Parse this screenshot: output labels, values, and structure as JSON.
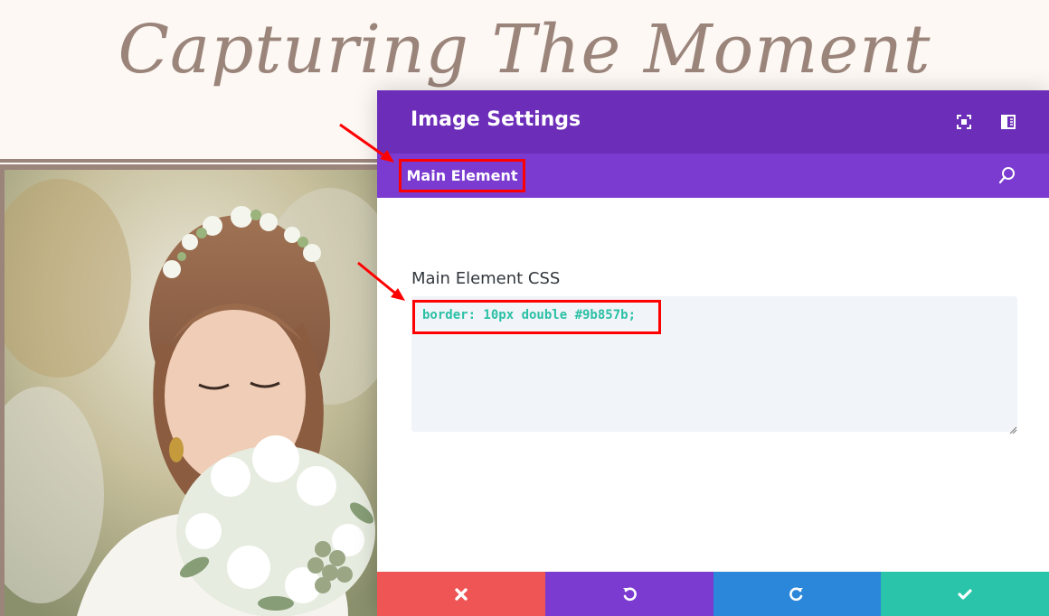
{
  "page": {
    "hero_title": "Capturing The Moment",
    "accent_color": "#9b857b"
  },
  "modal": {
    "title": "Image Settings",
    "header_icons": [
      "expand-icon",
      "sidebar-toggle-icon"
    ],
    "active_tab": "Main Element",
    "search_icon": "search-icon",
    "field_label": "Main Element CSS",
    "css_value": "border: 10px double #9b857b;",
    "colors": {
      "header": "#6c2eb9",
      "subbar": "#7b3bd0",
      "cancel": "#ef5555",
      "undo": "#7b3bd0",
      "redo": "#2b87da",
      "save": "#29c4a9",
      "highlight": "#ff0000"
    }
  },
  "footer": {
    "buttons": [
      "close-icon",
      "undo-icon",
      "redo-icon",
      "check-icon"
    ]
  }
}
